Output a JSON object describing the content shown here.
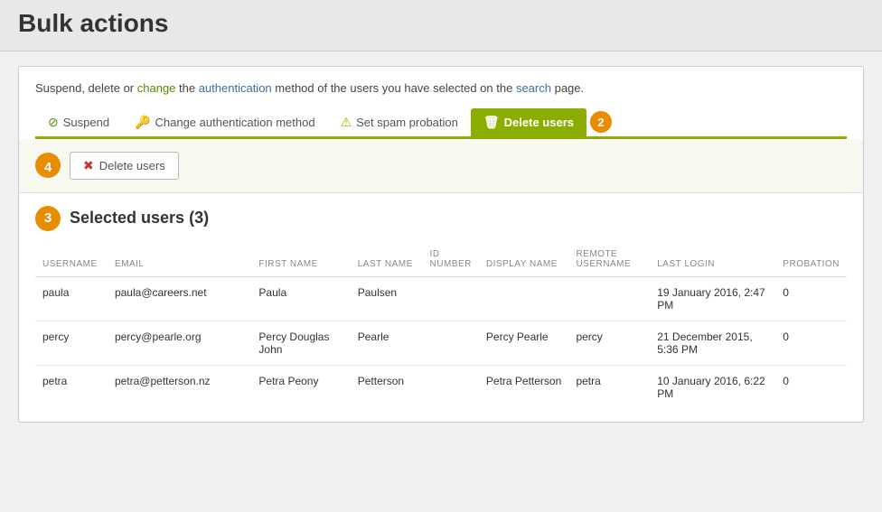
{
  "page": {
    "title": "Bulk actions"
  },
  "description": {
    "text_parts": [
      "Suspend, delete or ",
      "change",
      " the ",
      "authentication",
      " method of the users you have selected on the ",
      "search",
      " page."
    ]
  },
  "action_tabs": [
    {
      "id": "suspend",
      "label": "Suspend",
      "icon": "⊘",
      "icon_class": "suspend",
      "active": false
    },
    {
      "id": "change-auth",
      "label": "Change authentication method",
      "icon": "🔑",
      "icon_class": "change-auth",
      "active": false
    },
    {
      "id": "spam",
      "label": "Set spam probation",
      "icon": "⚠",
      "icon_class": "spam",
      "active": false
    },
    {
      "id": "delete-users",
      "label": "Delete users",
      "icon": "🗑",
      "icon_class": "delete-users-tab",
      "active": true
    }
  ],
  "badge": "2",
  "step4_badge": "4",
  "step3_badge": "3",
  "action_button": {
    "label": "Delete users",
    "icon": "✖"
  },
  "selected_users_title": "Selected users (3)",
  "table": {
    "headers": [
      "USERNAME",
      "EMAIL",
      "FIRST NAME",
      "LAST NAME",
      "ID NUMBER",
      "DISPLAY NAME",
      "REMOTE USERNAME",
      "LAST LOGIN",
      "PROBATION"
    ],
    "rows": [
      {
        "username": "paula",
        "email": "paula@careers.net",
        "firstname": "Paula",
        "lastname": "Paulsen",
        "idnumber": "",
        "displayname": "",
        "remoteusername": "",
        "lastlogin": "19 January 2016, 2:47 PM",
        "probation": "0"
      },
      {
        "username": "percy",
        "email": "percy@pearle.org",
        "firstname": "Percy Douglas John",
        "lastname": "Pearle",
        "idnumber": "",
        "displayname": "Percy Pearle",
        "remoteusername": "percy",
        "lastlogin": "21 December 2015, 5:36 PM",
        "probation": "0"
      },
      {
        "username": "petra",
        "email": "petra@petterson.nz",
        "firstname": "Petra Peony",
        "lastname": "Petterson",
        "idnumber": "",
        "displayname": "Petra Petterson",
        "remoteusername": "petra",
        "lastlogin": "10 January 2016, 6:22 PM",
        "probation": "0"
      }
    ]
  }
}
